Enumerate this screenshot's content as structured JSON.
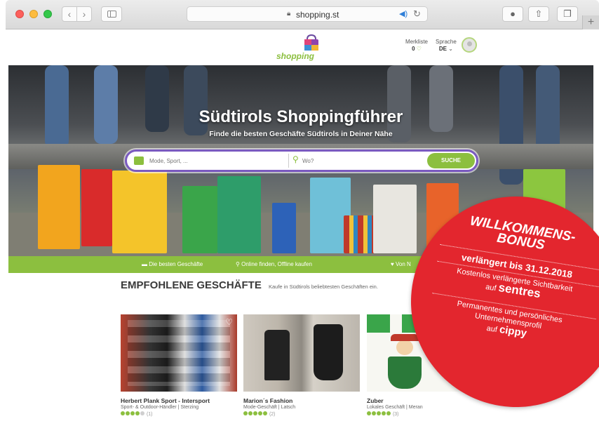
{
  "browser": {
    "url": "shopping.st",
    "back_glyph": "‹",
    "forward_glyph": "›"
  },
  "header": {
    "logo_text": "shopping",
    "merkliste_label": "Merkliste",
    "merkliste_count": "0",
    "sprache_label": "Sprache",
    "sprache_value": "DE"
  },
  "hero": {
    "title": "Südtirols Shoppingführer",
    "subtitle": "Finde die besten Geschäfte Südtirols in Deiner Nähe",
    "search_what_placeholder": "Mode, Sport, ...",
    "search_where_placeholder": "Wo?",
    "search_button": "SUCHE"
  },
  "greenbar": {
    "item1": "Die besten Geschäfte",
    "item2": "Online finden, Offline kaufen",
    "item3": "Von N"
  },
  "section": {
    "title": "EMPFOHLENE GESCHÄFTE",
    "subtitle": "Kaufe in Südtirols beliebtesten Geschäften ein."
  },
  "stores": [
    {
      "name": "Herbert Plank Sport - Intersport",
      "meta": "Sport- & Outdoor-Händler | Sterzing",
      "rating": 4,
      "reviews": "(1)"
    },
    {
      "name": "Marion´s Fashion",
      "meta": "Mode-Geschäft | Latsch",
      "rating": 5,
      "reviews": "(2)"
    },
    {
      "name": "Zuber",
      "meta": "Lokales Geschäft | Meran",
      "rating": 5,
      "reviews": "(3)"
    }
  ],
  "badge": {
    "title_line1": "WILLKOMMENS-",
    "title_line2": "BONUS",
    "date_line": "verlängert bis 31.12.2018",
    "p1_line1": "Kostenlos verlängerte Sichtbarkeit",
    "p1_line2": "auf",
    "brand1": "sentres",
    "p2_line1": "Permanentes und persönliches",
    "p2_line2": "Unternehmensprofil",
    "p2_line3": "auf",
    "brand2": "cippy"
  },
  "colors": {
    "brand_green": "#8cbf3f",
    "badge_red": "#e3262e",
    "search_border": "#7a5ac0"
  }
}
